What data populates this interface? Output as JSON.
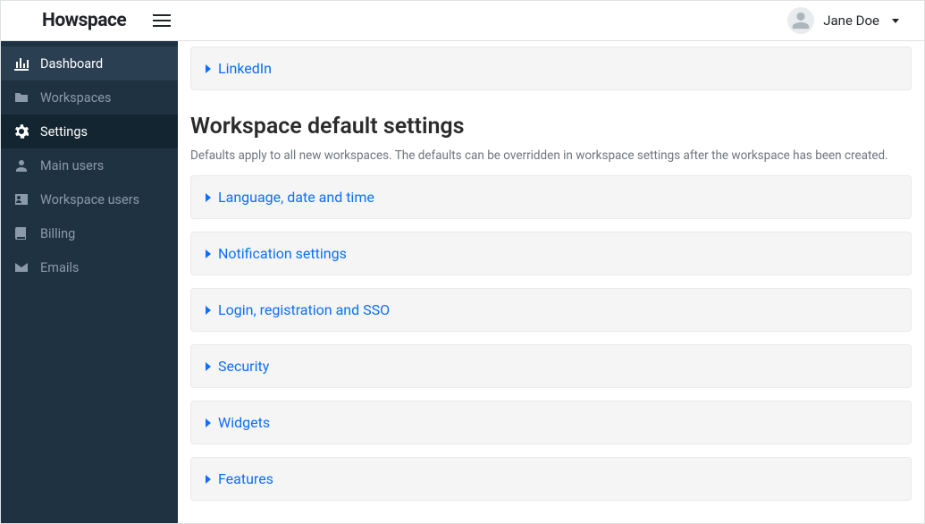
{
  "brand": "Howspace",
  "user": {
    "name": "Jane Doe"
  },
  "sidebar": {
    "items": [
      {
        "label": "Dashboard"
      },
      {
        "label": "Workspaces"
      },
      {
        "label": "Settings"
      },
      {
        "label": "Main users"
      },
      {
        "label": "Workspace users"
      },
      {
        "label": "Billing"
      },
      {
        "label": "Emails"
      }
    ]
  },
  "main": {
    "top_panel": {
      "label": "LinkedIn"
    },
    "section": {
      "title": "Workspace default settings",
      "subtitle": "Defaults apply to all new workspaces. The defaults can be overridden in workspace settings after the workspace has been created."
    },
    "panels": [
      {
        "label": "Language, date and time"
      },
      {
        "label": "Notification settings"
      },
      {
        "label": "Login, registration and SSO"
      },
      {
        "label": "Security"
      },
      {
        "label": "Widgets"
      },
      {
        "label": "Features"
      }
    ]
  }
}
